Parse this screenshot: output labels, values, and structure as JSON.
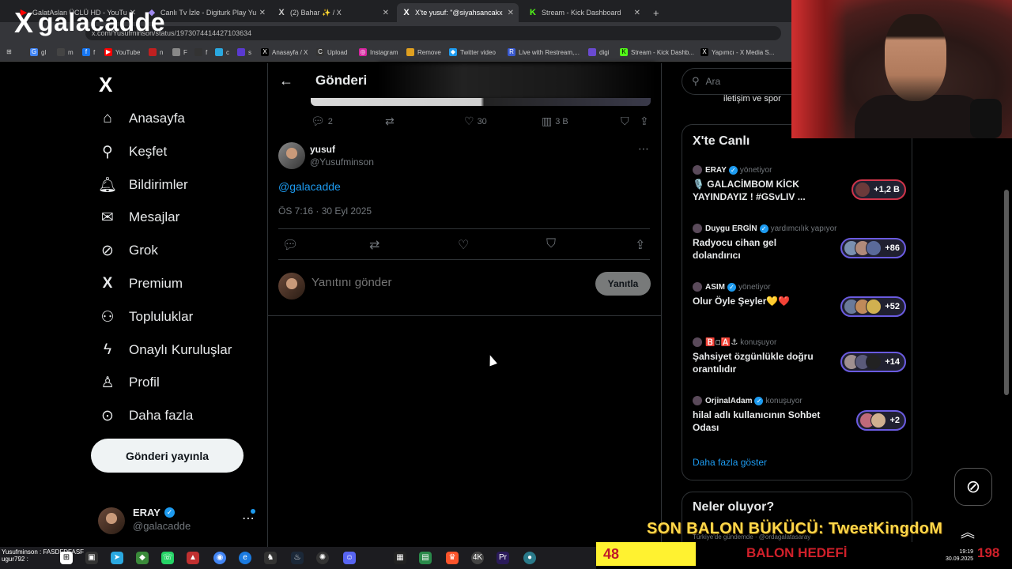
{
  "browser": {
    "tabs": [
      {
        "label": "GalatAslan ÜCLÜ HD - YouTube",
        "icon": "youtube-icon",
        "color": "#ff0000"
      },
      {
        "label": "Canlı Tv İzle - Digiturk Play Yurt Dışı",
        "icon": "digiturk-icon",
        "color": "#6a4ad0"
      },
      {
        "label": "(2) Bahar ✨ / X",
        "icon": "x-icon",
        "color": "#ffffff"
      },
      {
        "label": "X'te yusuf: \"@siyahsancakx @g...",
        "icon": "x-icon",
        "color": "#ffffff"
      },
      {
        "label": "Stream - Kick Dashboard",
        "icon": "kick-icon",
        "color": "#53fc18"
      }
    ],
    "new_tab": "+",
    "url": "x.com/Yusufminson/status/1973074414427103634",
    "bookmarks": [
      "gl",
      "m",
      "f",
      "YouTube",
      "n",
      "F",
      "f",
      "c",
      "s",
      "Anasayfa / X",
      "Upload",
      "Instagram",
      "Remove",
      "Twitter video",
      "Live with Restream,...",
      "digi",
      "Stream - Kick Dashb...",
      "Yapımcı - X Media S..."
    ]
  },
  "overlay_logo": {
    "x": "X",
    "text": "galacadde"
  },
  "nav": {
    "logo": "X",
    "items": [
      {
        "label": "Anasayfa",
        "icon": "home-icon",
        "glyph": "⌂"
      },
      {
        "label": "Keşfet",
        "icon": "search-icon",
        "glyph": "⚲"
      },
      {
        "label": "Bildirimler",
        "icon": "bell-icon",
        "glyph": "🔔"
      },
      {
        "label": "Mesajlar",
        "icon": "mail-icon",
        "glyph": "✉"
      },
      {
        "label": "Grok",
        "icon": "grok-icon",
        "glyph": "⊘"
      },
      {
        "label": "Premium",
        "icon": "x-premium-icon",
        "glyph": "X"
      },
      {
        "label": "Topluluklar",
        "icon": "communities-icon",
        "glyph": "👥"
      },
      {
        "label": "Onaylı Kuruluşlar",
        "icon": "lightning-icon",
        "glyph": "ϟ"
      },
      {
        "label": "Profil",
        "icon": "profile-icon",
        "glyph": "👤"
      },
      {
        "label": "Daha fazla",
        "icon": "more-circle-icon",
        "glyph": "⋯"
      }
    ],
    "post_button": "Gönderi yayınla",
    "profile": {
      "name": "ERAY",
      "handle": "@galacadde",
      "more": "⋯"
    }
  },
  "center": {
    "header_title": "Gönderi",
    "quoted_actions": {
      "replies": "2",
      "likes": "30",
      "views": "3 B"
    },
    "tweet": {
      "name": "yusuf",
      "handle": "@Yusufminson",
      "text": "@galacadde",
      "timestamp": "ÖS 7:16 · 30 Eyl 2025"
    },
    "reply_placeholder": "Yanıtını gönder",
    "reply_button": "Yanıtla"
  },
  "right": {
    "search_placeholder": "Ara",
    "prev_text": "iletişim ve spor",
    "live_title": "X'te Canlı",
    "live_items": [
      {
        "host": "ERAY",
        "role": "yönetiyor",
        "title": "🎙️ GALACİMBOM KİCK YAYINDAYIZ ! #GSvLIV ...",
        "count": "+1,2 B",
        "pill": "red"
      },
      {
        "host": "Duygu ERGİN",
        "role": "yardımcılık yapıyor",
        "title": "Radyocu cihan gel dolandırıcı",
        "count": "+86",
        "pill": "blue"
      },
      {
        "host": "ASIM",
        "role": "yönetiyor",
        "title": "Olur Öyle Şeyler💛❤️",
        "count": "+52",
        "pill": "blue"
      },
      {
        "host": "🅱️◽🅰️⚓",
        "role": "konuşuyor",
        "title": "Şahsiyet özgünlükle doğru orantılıdır",
        "count": "+14",
        "pill": "blue"
      },
      {
        "host": "OrjinalAdam",
        "role": "konuşuyor",
        "title": "hilal adlı kullanıcının Sohbet Odası",
        "count": "+2",
        "pill": "blue"
      }
    ],
    "show_more": "Daha fazla göster",
    "whats_happening": "Neler oluyor?",
    "whats_sub": "Türkiye'de gündemde · @ordagalatasaray"
  },
  "stream_overlay": {
    "banner": "SON BALON BÜKÜCÜ: TweetKingdoM",
    "progress_value": "48",
    "goal_label": "BALON HEDEFİ",
    "goal_value": "198",
    "progress_fraction": 0.24,
    "accent": "#ffd84a"
  },
  "taskbar": {
    "ticker": "Yusufminson : FASDFDFASF",
    "ticker2": "ugur792 :",
    "time": "19:19",
    "date": "30.09.2025"
  }
}
